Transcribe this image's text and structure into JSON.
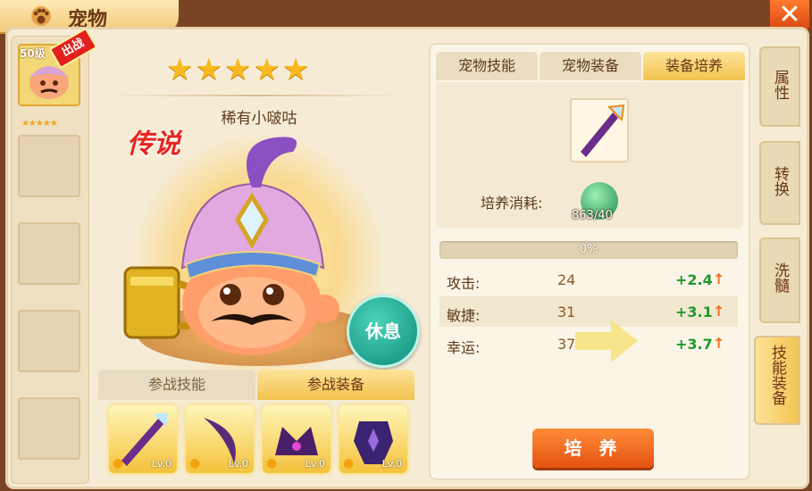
{
  "window": {
    "title": "宠物",
    "close_label": "✕"
  },
  "slots": {
    "pet_level": "50级",
    "pet_badge": "出战",
    "pet_stars": "★★★★★"
  },
  "pet": {
    "stars": "★★★★★",
    "name": "稀有小啵咕",
    "rarity": "传说",
    "rest_label": "休息"
  },
  "sub_tabs": {
    "skills": "参战技能",
    "equipment": "参战装备"
  },
  "equipment_slots": [
    {
      "level": "Lv.0"
    },
    {
      "level": "Lv.0"
    },
    {
      "level": "Lv.0"
    },
    {
      "level": "Lv.0"
    }
  ],
  "right_tabs": [
    "宠物技能",
    "宠物装备",
    "装备培养"
  ],
  "cultivate": {
    "cost_label": "培养消耗:",
    "cost_value": "863/40",
    "progress_percent": 0,
    "progress_text": "0%",
    "stats": [
      {
        "name": "攻击:",
        "value": "24",
        "increase": "+2.4"
      },
      {
        "name": "敏捷:",
        "value": "31",
        "increase": "+3.1"
      },
      {
        "name": "幸运:",
        "value": "37",
        "increase": "+3.7"
      }
    ],
    "button_label": "培 养"
  },
  "side_tabs": [
    "属性",
    "转换",
    "洗髓",
    "技能装备"
  ],
  "colors": {
    "accent": "#f3c24e",
    "increase": "#1e9a2c",
    "button": "#e4520f",
    "rest_button": "#0f8c7a"
  }
}
